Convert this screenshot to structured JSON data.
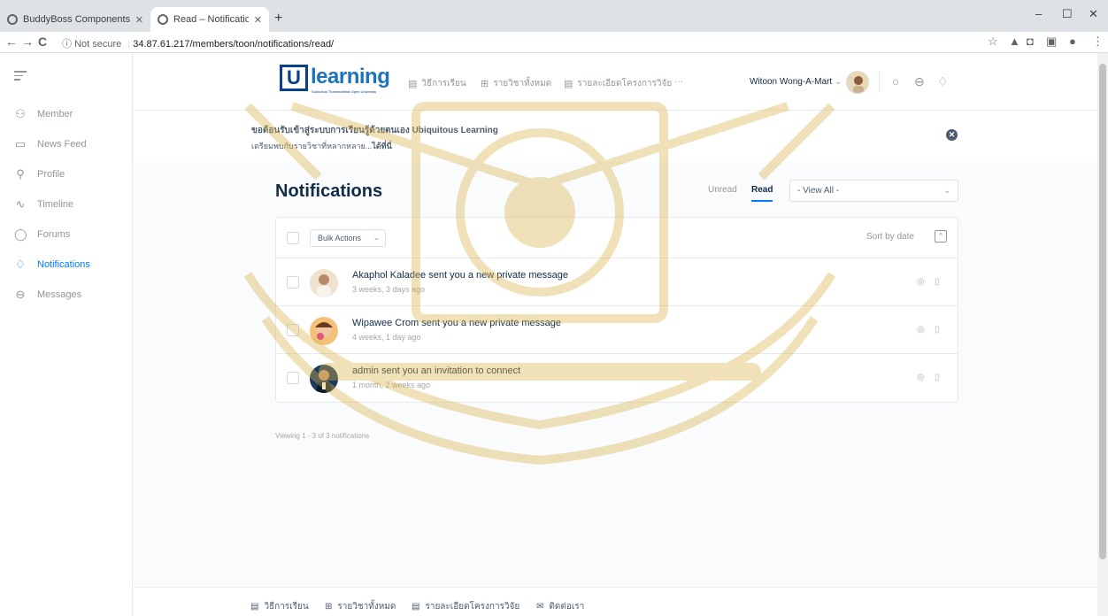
{
  "browser": {
    "tabs": [
      {
        "title": "BuddyBoss Components - U-Lea",
        "active": false
      },
      {
        "title": "Read – Notifications – Witoon W",
        "active": true
      }
    ],
    "new_tab": "+",
    "window_controls": {
      "minimize": "–",
      "maximize": "☐",
      "close": "✕"
    },
    "url_secure_label": "Not secure",
    "url": "34.87.61.217/members/toon/notifications/read/",
    "nav": {
      "back": "←",
      "forward": "→",
      "reload": "C"
    }
  },
  "sidebar": {
    "items": [
      {
        "label": "Member",
        "icon": "users-icon",
        "glyph": "⚇"
      },
      {
        "label": "News Feed",
        "icon": "news-feed-icon",
        "glyph": "▭"
      },
      {
        "label": "Profile",
        "icon": "user-icon",
        "glyph": "⚲"
      },
      {
        "label": "Timeline",
        "icon": "activity-icon",
        "glyph": "∿"
      },
      {
        "label": "Forums",
        "icon": "chat-icon",
        "glyph": "◯"
      },
      {
        "label": "Notifications",
        "icon": "bell-icon",
        "glyph": "♢",
        "active": true
      },
      {
        "label": "Messages",
        "icon": "inbox-icon",
        "glyph": "⊖"
      }
    ]
  },
  "header": {
    "logo_letter": "U",
    "logo_text": "learning",
    "logo_sub": "Sukhothai Thammathirat Open University",
    "nav": [
      {
        "label": "วิธีการเรียน",
        "icon": "document-icon",
        "glyph": "▤"
      },
      {
        "label": "รายวิชาทั้งหมด",
        "icon": "grid-icon",
        "glyph": "⊞"
      },
      {
        "label": "รายละเอียดโครงการวิจัย",
        "icon": "list-icon",
        "glyph": "▤"
      },
      {
        "label": "···",
        "icon": "more-icon",
        "glyph": ""
      }
    ],
    "user_name": "Witoon Wong-A-Mart",
    "user_chevron": "⌄",
    "search_glyph": "○",
    "inbox_glyph": "⊖",
    "bell_glyph": "♢"
  },
  "banner": {
    "line1": "ขอต้อนรับเข้าสู่ระบบการเรียนรู้ด้วยตนเอง Ubiquitous Learning",
    "line2_prefix": "เตรียมพบกับรายวิชาที่หลากหลาย...",
    "line2_link": "ได้ที่นี่",
    "close_glyph": "✕"
  },
  "main": {
    "title": "Notifications",
    "filter_unread": "Unread",
    "filter_read": "Read",
    "view_select": "- View All -",
    "bulk_actions": "Bulk Actions",
    "sort_label": "Sort by date",
    "sort_glyph": "^",
    "notifications": [
      {
        "text": "Akaphol Kaladee sent you a new private message",
        "time": "3 weeks, 3 days ago",
        "avatar_color": "#efe3cf"
      },
      {
        "text": "Wipawee Crom sent you a new private message",
        "time": "4 weeks, 1 day ago",
        "avatar_color": "#f3c27a"
      },
      {
        "text": "admin sent you an invitation to connect",
        "time": "1 month, 2 weeks ago",
        "avatar_color": "#1f3b5c"
      }
    ],
    "viewing": "Viewing 1 - 3 of 3 notifications"
  },
  "footer": {
    "links": [
      {
        "label": "วิธีการเรียน",
        "glyph": "▤"
      },
      {
        "label": "รายวิชาทั้งหมด",
        "glyph": "⊞"
      },
      {
        "label": "รายละเอียดโครงการวิจัย",
        "glyph": "▤"
      },
      {
        "label": "ติดต่อเรา",
        "glyph": "✉"
      }
    ]
  },
  "colors": {
    "accent": "#007cff",
    "text": "#122b46",
    "muted": "#939597",
    "watermark": "#d8b24a"
  }
}
